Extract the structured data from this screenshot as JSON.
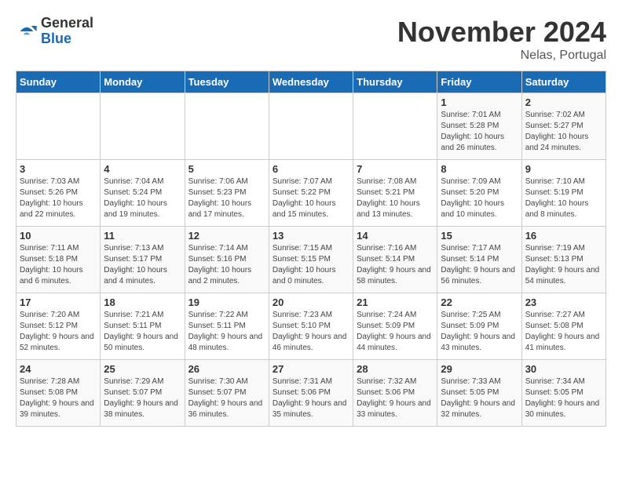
{
  "logo": {
    "general": "General",
    "blue": "Blue"
  },
  "title": "November 2024",
  "location": "Nelas, Portugal",
  "days_header": [
    "Sunday",
    "Monday",
    "Tuesday",
    "Wednesday",
    "Thursday",
    "Friday",
    "Saturday"
  ],
  "weeks": [
    [
      {
        "day": "",
        "info": ""
      },
      {
        "day": "",
        "info": ""
      },
      {
        "day": "",
        "info": ""
      },
      {
        "day": "",
        "info": ""
      },
      {
        "day": "",
        "info": ""
      },
      {
        "day": "1",
        "info": "Sunrise: 7:01 AM\nSunset: 5:28 PM\nDaylight: 10 hours and 26 minutes."
      },
      {
        "day": "2",
        "info": "Sunrise: 7:02 AM\nSunset: 5:27 PM\nDaylight: 10 hours and 24 minutes."
      }
    ],
    [
      {
        "day": "3",
        "info": "Sunrise: 7:03 AM\nSunset: 5:26 PM\nDaylight: 10 hours and 22 minutes."
      },
      {
        "day": "4",
        "info": "Sunrise: 7:04 AM\nSunset: 5:24 PM\nDaylight: 10 hours and 19 minutes."
      },
      {
        "day": "5",
        "info": "Sunrise: 7:06 AM\nSunset: 5:23 PM\nDaylight: 10 hours and 17 minutes."
      },
      {
        "day": "6",
        "info": "Sunrise: 7:07 AM\nSunset: 5:22 PM\nDaylight: 10 hours and 15 minutes."
      },
      {
        "day": "7",
        "info": "Sunrise: 7:08 AM\nSunset: 5:21 PM\nDaylight: 10 hours and 13 minutes."
      },
      {
        "day": "8",
        "info": "Sunrise: 7:09 AM\nSunset: 5:20 PM\nDaylight: 10 hours and 10 minutes."
      },
      {
        "day": "9",
        "info": "Sunrise: 7:10 AM\nSunset: 5:19 PM\nDaylight: 10 hours and 8 minutes."
      }
    ],
    [
      {
        "day": "10",
        "info": "Sunrise: 7:11 AM\nSunset: 5:18 PM\nDaylight: 10 hours and 6 minutes."
      },
      {
        "day": "11",
        "info": "Sunrise: 7:13 AM\nSunset: 5:17 PM\nDaylight: 10 hours and 4 minutes."
      },
      {
        "day": "12",
        "info": "Sunrise: 7:14 AM\nSunset: 5:16 PM\nDaylight: 10 hours and 2 minutes."
      },
      {
        "day": "13",
        "info": "Sunrise: 7:15 AM\nSunset: 5:15 PM\nDaylight: 10 hours and 0 minutes."
      },
      {
        "day": "14",
        "info": "Sunrise: 7:16 AM\nSunset: 5:14 PM\nDaylight: 9 hours and 58 minutes."
      },
      {
        "day": "15",
        "info": "Sunrise: 7:17 AM\nSunset: 5:14 PM\nDaylight: 9 hours and 56 minutes."
      },
      {
        "day": "16",
        "info": "Sunrise: 7:19 AM\nSunset: 5:13 PM\nDaylight: 9 hours and 54 minutes."
      }
    ],
    [
      {
        "day": "17",
        "info": "Sunrise: 7:20 AM\nSunset: 5:12 PM\nDaylight: 9 hours and 52 minutes."
      },
      {
        "day": "18",
        "info": "Sunrise: 7:21 AM\nSunset: 5:11 PM\nDaylight: 9 hours and 50 minutes."
      },
      {
        "day": "19",
        "info": "Sunrise: 7:22 AM\nSunset: 5:11 PM\nDaylight: 9 hours and 48 minutes."
      },
      {
        "day": "20",
        "info": "Sunrise: 7:23 AM\nSunset: 5:10 PM\nDaylight: 9 hours and 46 minutes."
      },
      {
        "day": "21",
        "info": "Sunrise: 7:24 AM\nSunset: 5:09 PM\nDaylight: 9 hours and 44 minutes."
      },
      {
        "day": "22",
        "info": "Sunrise: 7:25 AM\nSunset: 5:09 PM\nDaylight: 9 hours and 43 minutes."
      },
      {
        "day": "23",
        "info": "Sunrise: 7:27 AM\nSunset: 5:08 PM\nDaylight: 9 hours and 41 minutes."
      }
    ],
    [
      {
        "day": "24",
        "info": "Sunrise: 7:28 AM\nSunset: 5:08 PM\nDaylight: 9 hours and 39 minutes."
      },
      {
        "day": "25",
        "info": "Sunrise: 7:29 AM\nSunset: 5:07 PM\nDaylight: 9 hours and 38 minutes."
      },
      {
        "day": "26",
        "info": "Sunrise: 7:30 AM\nSunset: 5:07 PM\nDaylight: 9 hours and 36 minutes."
      },
      {
        "day": "27",
        "info": "Sunrise: 7:31 AM\nSunset: 5:06 PM\nDaylight: 9 hours and 35 minutes."
      },
      {
        "day": "28",
        "info": "Sunrise: 7:32 AM\nSunset: 5:06 PM\nDaylight: 9 hours and 33 minutes."
      },
      {
        "day": "29",
        "info": "Sunrise: 7:33 AM\nSunset: 5:05 PM\nDaylight: 9 hours and 32 minutes."
      },
      {
        "day": "30",
        "info": "Sunrise: 7:34 AM\nSunset: 5:05 PM\nDaylight: 9 hours and 30 minutes."
      }
    ]
  ]
}
